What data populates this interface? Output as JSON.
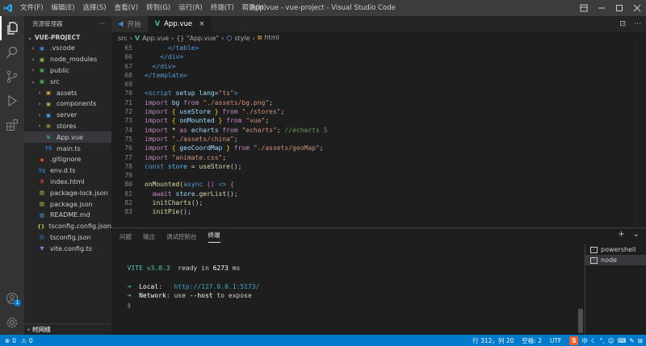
{
  "titlebar": {
    "title": "App.vue - vue-project - Visual Studio Code",
    "menus": [
      "文件(F)",
      "编辑(E)",
      "选择(S)",
      "查看(V)",
      "转到(G)",
      "运行(R)",
      "终端(T)",
      "帮助(H)"
    ]
  },
  "sidebar": {
    "header": "资源管理器",
    "more": "···",
    "project": "VUE-PROJECT",
    "timeline": "时间线",
    "items": [
      {
        "label": ".vscode",
        "indent": 1,
        "chevron": "›",
        "icon": "vscode-folder-icon",
        "icon_glyph": "▣",
        "icon_color": "#3b8ad8",
        "selected": false
      },
      {
        "label": "node_modules",
        "indent": 1,
        "chevron": "›",
        "icon": "node-folder-icon",
        "icon_glyph": "▣",
        "icon_color": "#8bc34a",
        "selected": false
      },
      {
        "label": "public",
        "indent": 1,
        "chevron": "›",
        "icon": "public-folder-icon",
        "icon_glyph": "▣",
        "icon_color": "#4caf50",
        "selected": false
      },
      {
        "label": "src",
        "indent": 1,
        "chevron": "⌄",
        "icon": "src-folder-icon",
        "icon_glyph": "▣",
        "icon_color": "#4caf50",
        "selected": false
      },
      {
        "label": "assets",
        "indent": 2,
        "chevron": "›",
        "icon": "assets-folder-icon",
        "icon_glyph": "▣",
        "icon_color": "#d9a441",
        "selected": false
      },
      {
        "label": "components",
        "indent": 2,
        "chevron": "›",
        "icon": "components-folder-icon",
        "icon_glyph": "▣",
        "icon_color": "#c0a34d",
        "selected": false
      },
      {
        "label": "server",
        "indent": 2,
        "chevron": "›",
        "icon": "server-folder-icon",
        "icon_glyph": "▣",
        "icon_color": "#42a5f5",
        "selected": false
      },
      {
        "label": "stores",
        "indent": 2,
        "chevron": "›",
        "icon": "stores-folder-icon",
        "icon_glyph": "▣",
        "icon_color": "#a08040",
        "selected": false
      },
      {
        "label": "App.vue",
        "indent": 2,
        "chevron": "",
        "icon": "vue-file-icon",
        "icon_glyph": "V",
        "icon_color": "#41b883",
        "selected": true
      },
      {
        "label": "main.ts",
        "indent": 2,
        "chevron": "",
        "icon": "ts-file-icon",
        "icon_glyph": "TS",
        "icon_color": "#3178c6",
        "selected": false
      },
      {
        "label": ".gitignore",
        "indent": 1,
        "chevron": "",
        "icon": "git-file-icon",
        "icon_glyph": "◆",
        "icon_color": "#e64a19",
        "selected": false
      },
      {
        "label": "env.d.ts",
        "indent": 1,
        "chevron": "",
        "icon": "ts-file-icon",
        "icon_glyph": "TS",
        "icon_color": "#3178c6",
        "selected": false
      },
      {
        "label": "index.html",
        "indent": 1,
        "chevron": "",
        "icon": "html-file-icon",
        "icon_glyph": "5",
        "icon_color": "#e44d26",
        "selected": false
      },
      {
        "label": "package-lock.json",
        "indent": 1,
        "chevron": "",
        "icon": "json-file-icon",
        "icon_glyph": "▤",
        "icon_color": "#cbcb41",
        "selected": false
      },
      {
        "label": "package.json",
        "indent": 1,
        "chevron": "",
        "icon": "json-file-icon",
        "icon_glyph": "▤",
        "icon_color": "#cbcb41",
        "selected": false
      },
      {
        "label": "README.md",
        "indent": 1,
        "chevron": "",
        "icon": "readme-file-icon",
        "icon_glyph": "▤",
        "icon_color": "#42a5f5",
        "selected": false
      },
      {
        "label": "tsconfig.config.json",
        "indent": 1,
        "chevron": "",
        "icon": "tsconfig-file-icon",
        "icon_glyph": "{}",
        "icon_color": "#cbcb41",
        "selected": false
      },
      {
        "label": "tsconfig.json",
        "indent": 1,
        "chevron": "",
        "icon": "tsconfig-file-icon",
        "icon_glyph": "▤",
        "icon_color": "#3178c6",
        "selected": false
      },
      {
        "label": "vite.config.ts",
        "indent": 1,
        "chevron": "",
        "icon": "vite-file-icon",
        "icon_glyph": "▼",
        "icon_color": "#a86cf2",
        "selected": false
      }
    ]
  },
  "tabs": [
    {
      "label": "开始",
      "icon": "vscode-icon",
      "icon_glyph": "◀",
      "icon_color": "#3b8ad8",
      "active": false
    },
    {
      "label": "App.vue",
      "icon": "vue-file-icon",
      "icon_glyph": "V",
      "icon_color": "#41b883",
      "active": true
    }
  ],
  "tab_close": "×",
  "tabbar_actions": [
    "⊡",
    "⋯"
  ],
  "breadcrumb": {
    "parts": [
      {
        "text": "src",
        "icon": ""
      },
      {
        "text": "App.vue",
        "icon": "vue-file-icon"
      },
      {
        "text": "{} \"App.vue\"",
        "icon": ""
      },
      {
        "text": "style",
        "icon": "style-icon"
      },
      {
        "text": "html",
        "icon": "html-tag-icon"
      }
    ],
    "separator": "›"
  },
  "editor": {
    "lines": [
      {
        "n": "65",
        "tokens": [
          [
            "      ",
            "#d4d4d4"
          ],
          [
            "</table>",
            "#569cd6"
          ]
        ]
      },
      {
        "n": "66",
        "tokens": [
          [
            "    ",
            "#d4d4d4"
          ],
          [
            "</div>",
            "#569cd6"
          ]
        ]
      },
      {
        "n": "67",
        "tokens": [
          [
            "  ",
            "#d4d4d4"
          ],
          [
            "</div>",
            "#569cd6"
          ]
        ]
      },
      {
        "n": "68",
        "tokens": [
          [
            "</template>",
            "#569cd6"
          ]
        ]
      },
      {
        "n": "69",
        "tokens": []
      },
      {
        "n": "70",
        "tokens": [
          [
            "<script ",
            "#569cd6"
          ],
          [
            "setup ",
            "#9cdcfe"
          ],
          [
            "lang",
            "#9cdcfe"
          ],
          [
            "=",
            "#d4d4d4"
          ],
          [
            "\"ts\"",
            "#ce9178"
          ],
          [
            ">",
            "#569cd6"
          ]
        ]
      },
      {
        "n": "71",
        "tokens": [
          [
            "import ",
            "#c586c0"
          ],
          [
            "bg ",
            "#9cdcfe"
          ],
          [
            "from ",
            "#c586c0"
          ],
          [
            "\"./assets/bg.png\"",
            "#ce9178"
          ],
          [
            ";",
            "#d4d4d4"
          ]
        ]
      },
      {
        "n": "72",
        "tokens": [
          [
            "import ",
            "#c586c0"
          ],
          [
            "{ ",
            "#ffd700"
          ],
          [
            "useStore ",
            "#9cdcfe"
          ],
          [
            "} ",
            "#ffd700"
          ],
          [
            "from ",
            "#c586c0"
          ],
          [
            "\"./stores\"",
            "#ce9178"
          ],
          [
            ";",
            "#d4d4d4"
          ]
        ]
      },
      {
        "n": "73",
        "tokens": [
          [
            "import ",
            "#c586c0"
          ],
          [
            "{ ",
            "#ffd700"
          ],
          [
            "onMounted ",
            "#9cdcfe"
          ],
          [
            "} ",
            "#ffd700"
          ],
          [
            "from ",
            "#c586c0"
          ],
          [
            "\"vue\"",
            "#ce9178"
          ],
          [
            ";",
            "#d4d4d4"
          ]
        ]
      },
      {
        "n": "74",
        "tokens": [
          [
            "import ",
            "#c586c0"
          ],
          [
            "* ",
            "#d4d4d4"
          ],
          [
            "as ",
            "#c586c0"
          ],
          [
            "echarts ",
            "#9cdcfe"
          ],
          [
            "from ",
            "#c586c0"
          ],
          [
            "\"echarts\"",
            "#ce9178"
          ],
          [
            "; ",
            "#d4d4d4"
          ],
          [
            "//echarts 5",
            "#6a9955"
          ]
        ]
      },
      {
        "n": "75",
        "tokens": [
          [
            "import ",
            "#c586c0"
          ],
          [
            "\"./assets/china\"",
            "#ce9178"
          ],
          [
            ";",
            "#d4d4d4"
          ]
        ]
      },
      {
        "n": "76",
        "tokens": [
          [
            "import ",
            "#c586c0"
          ],
          [
            "{ ",
            "#ffd700"
          ],
          [
            "geoCoordMap ",
            "#9cdcfe"
          ],
          [
            "} ",
            "#ffd700"
          ],
          [
            "from ",
            "#c586c0"
          ],
          [
            "\"./assets/geoMap\"",
            "#ce9178"
          ],
          [
            ";",
            "#d4d4d4"
          ]
        ]
      },
      {
        "n": "77",
        "tokens": [
          [
            "import ",
            "#c586c0"
          ],
          [
            "\"animate.css\"",
            "#ce9178"
          ],
          [
            ";",
            "#d4d4d4"
          ]
        ]
      },
      {
        "n": "78",
        "tokens": [
          [
            "const ",
            "#569cd6"
          ],
          [
            "store ",
            "#4fc1ff"
          ],
          [
            "= ",
            "#d4d4d4"
          ],
          [
            "useStore",
            "#dcdcaa"
          ],
          [
            "();",
            "#d4d4d4"
          ]
        ]
      },
      {
        "n": "79",
        "tokens": []
      },
      {
        "n": "80",
        "tokens": [
          [
            "onMounted",
            "#dcdcaa"
          ],
          [
            "(",
            "#ffd700"
          ],
          [
            "async ",
            "#569cd6"
          ],
          [
            "() ",
            "#da70d6"
          ],
          [
            "=> ",
            "#569cd6"
          ],
          [
            "{",
            "#da70d6"
          ]
        ]
      },
      {
        "n": "81",
        "tokens": [
          [
            "  ",
            "#d4d4d4"
          ],
          [
            "await ",
            "#c586c0"
          ],
          [
            "store",
            "#9cdcfe"
          ],
          [
            ".",
            "#d4d4d4"
          ],
          [
            "gerList",
            "#dcdcaa"
          ],
          [
            "();",
            "#d4d4d4"
          ]
        ]
      },
      {
        "n": "82",
        "tokens": [
          [
            "  ",
            "#d4d4d4"
          ],
          [
            "initCharts",
            "#dcdcaa"
          ],
          [
            "();",
            "#d4d4d4"
          ]
        ]
      },
      {
        "n": "83",
        "tokens": [
          [
            "  ",
            "#d4d4d4"
          ],
          [
            "initPie",
            "#dcdcaa"
          ],
          [
            "();",
            "#d4d4d4"
          ]
        ]
      }
    ]
  },
  "panel": {
    "tabs": [
      "问题",
      "输出",
      "调试控制台",
      "终端"
    ],
    "active_tab": 3,
    "actions": [
      "+",
      "⌄"
    ],
    "terminal_lines": [
      [],
      [
        [
          "  VITE ",
          "#4ec9b0"
        ],
        [
          "v3.0.3  ",
          "#4ec9b0"
        ],
        [
          "ready in ",
          "#cccccc"
        ],
        [
          "6273",
          "#ffffff"
        ],
        [
          " ms",
          "#cccccc"
        ]
      ],
      [],
      [
        [
          "  ➜  ",
          "#4ec9b0"
        ],
        [
          "Local",
          "#ffffff"
        ],
        [
          ":   ",
          "#cccccc"
        ],
        [
          "http://127.0.0.1:5173/",
          "#3fa8c8"
        ]
      ],
      [
        [
          "  ➜  ",
          "#4ec9b0"
        ],
        [
          "Network",
          "#ffffff"
        ],
        [
          ": use ",
          "#cccccc"
        ],
        [
          "--host",
          "#ffffff"
        ],
        [
          " to expose",
          "#cccccc"
        ]
      ],
      [
        [
          "  ▯",
          "#cccccc"
        ]
      ]
    ],
    "terminals": [
      {
        "label": "powershell",
        "active": false
      },
      {
        "label": "node",
        "active": true
      }
    ]
  },
  "statusbar": {
    "errors": "0",
    "warnings": "0",
    "position": "行 312，列 20",
    "spaces": "空格: 2",
    "encoding": "UTF",
    "ime": "中",
    "notifications_badge": "1"
  },
  "colors": {
    "accent": "#007acc",
    "activity_bar": "#333333",
    "sidebar": "#252526",
    "editor": "#1e1e1e"
  }
}
